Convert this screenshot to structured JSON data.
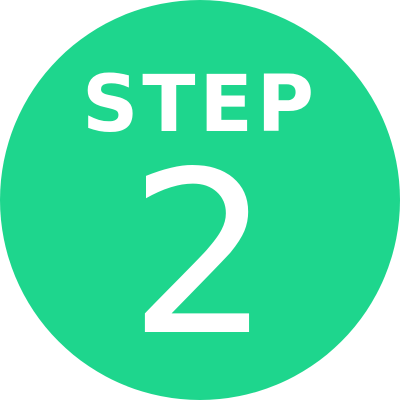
{
  "badge": {
    "label": "STEP",
    "number": "2",
    "colors": {
      "fill": "#1ed68d",
      "text": "#ffffff",
      "background": "#ffffff"
    }
  }
}
